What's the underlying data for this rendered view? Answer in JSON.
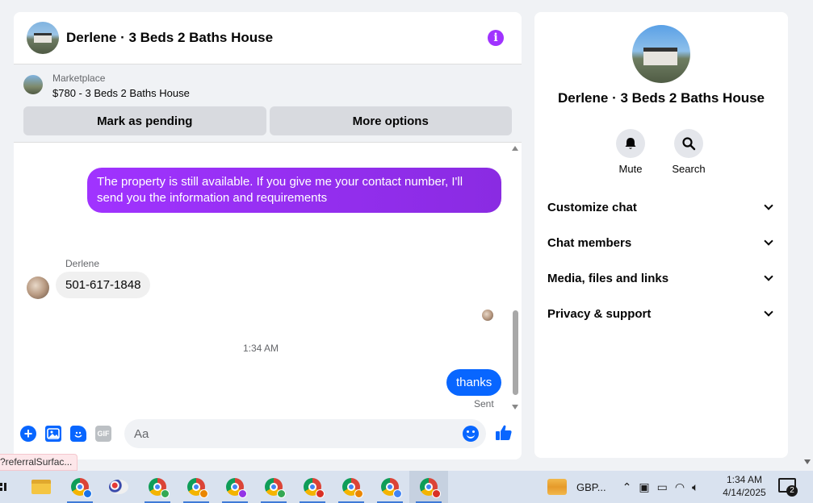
{
  "chat": {
    "title": "Derlene · 3 Beds 2 Baths House",
    "marketplace_label": "Marketplace",
    "listing": "$780 - 3 Beds 2 Baths House",
    "mark_pending": "Mark as pending",
    "more_options": "More options",
    "messages": {
      "outgoing_1": "The property is still available. If you give me your contact number, I'll send you the information and requirements",
      "sender_name": "Derlene",
      "incoming_1": "501-617-1848",
      "timestamp": "1:34 AM",
      "outgoing_2": "thanks",
      "status": "Sent"
    },
    "composer": {
      "placeholder": "Aa",
      "gif_label": "GIF"
    }
  },
  "info_panel": {
    "title": "Derlene · 3 Beds 2 Baths House",
    "actions": {
      "mute": "Mute",
      "search": "Search"
    },
    "sections": [
      "Customize chat",
      "Chat members",
      "Media, files and links",
      "Privacy & support"
    ]
  },
  "status_url": "?referralSurfac...",
  "taskbar": {
    "tray_app": "GBP...",
    "time": "1:34 AM",
    "date": "4/14/2025",
    "notification_count": "2",
    "badge_colors": [
      "#1a73e8",
      "#34a853",
      "#ea8600",
      "#9334e6",
      "#34a853",
      "#d93025",
      "#ea8600",
      "#4285f4",
      "#d93025"
    ]
  },
  "colors": {
    "accent_purple": "#a033ff",
    "accent_blue": "#0866ff"
  }
}
